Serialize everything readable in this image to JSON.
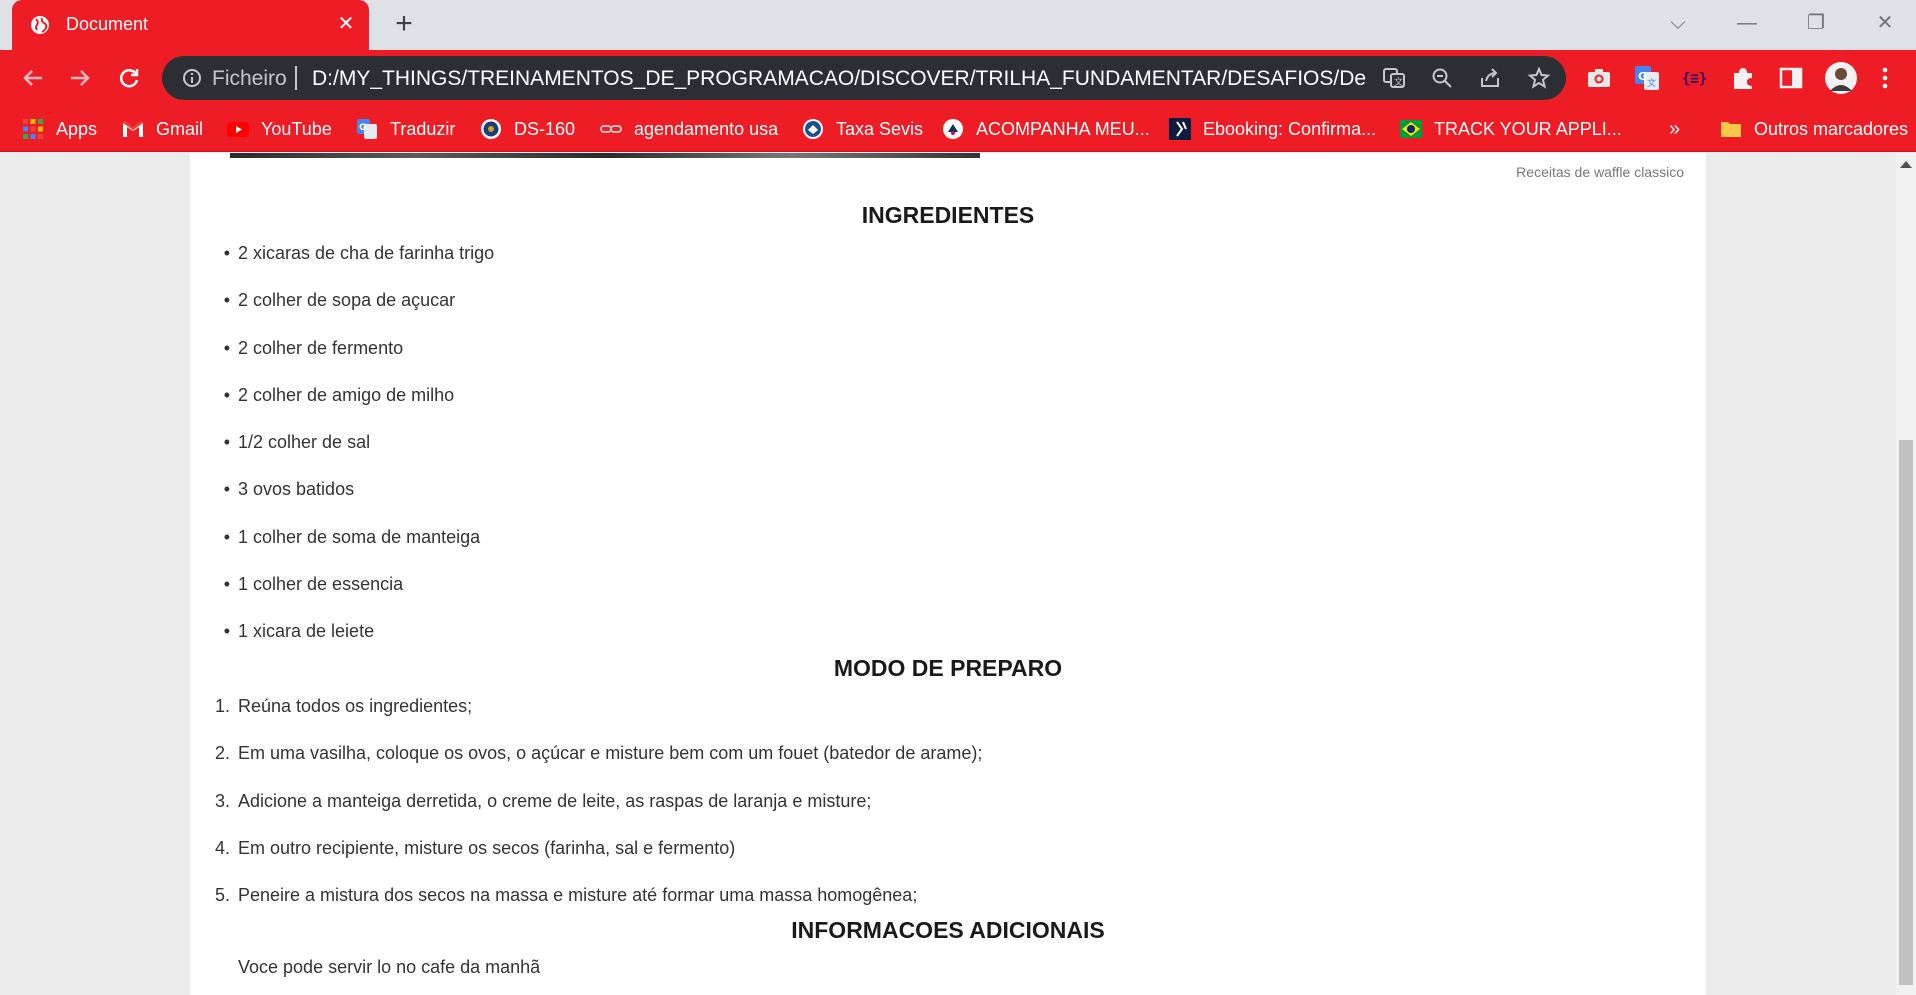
{
  "browser": {
    "tab_title": "Document",
    "tab_close": "✕",
    "new_tab": "+",
    "window_controls": {
      "dropdown": "⌵",
      "minimize": "—",
      "restore": "❐",
      "close": "✕"
    },
    "address": {
      "scheme_label": "Ficheiro",
      "url": "D:/MY_THINGS/TREINAMENTOS_DE_PROGRAMACAO/DISCOVER/TRILHA_FUNDAMENTAR/DESAFIOS/Desafio%..."
    },
    "bookmarks": [
      {
        "label": "Apps",
        "icon": "apps-grid-icon"
      },
      {
        "label": "Gmail",
        "icon": "gmail-icon"
      },
      {
        "label": "YouTube",
        "icon": "youtube-icon"
      },
      {
        "label": "Traduzir",
        "icon": "translate-icon"
      },
      {
        "label": "DS-160",
        "icon": "seal-icon"
      },
      {
        "label": "agendamento usa",
        "icon": "link-icon"
      },
      {
        "label": "Taxa Sevis",
        "icon": "dhs-seal-icon"
      },
      {
        "label": "ACOMPANHA MEU...",
        "icon": "uscis-icon"
      },
      {
        "label": "Ebooking: Confirma...",
        "icon": "ebooking-icon"
      },
      {
        "label": "TRACK YOUR APPLI...",
        "icon": "brazil-flag-icon"
      }
    ],
    "bookmarks_overflow": "»",
    "other_bookmarks": "Outros marcadores",
    "colors": {
      "chrome_red": "#ee1c25",
      "omnibox": "#2b2e33"
    }
  },
  "page": {
    "image_caption": "Receitas de waffle classico",
    "ingredients": {
      "title": "INGREDIENTES",
      "items": [
        "2 xicaras de cha de farinha trigo",
        "2 colher de sopa de açucar",
        "2 colher de fermento",
        "2 colher de amigo de milho",
        "1/2 colher de sal",
        "3 ovos batidos",
        "1 colher de soma de manteiga",
        "1 colher de essencia",
        "1 xicara de leiete"
      ]
    },
    "preparation": {
      "title": "MODO DE PREPARO",
      "steps": [
        "Reúna todos os ingredientes;",
        "Em uma vasilha, coloque os ovos, o açúcar e misture bem com um fouet (batedor de arame);",
        "Adicione a manteiga derretida, o creme de leite, as raspas de laranja e misture;",
        "Em outro recipiente, misture os secos (farinha, sal e fermento)",
        "Peneire a mistura dos secos na massa e misture até formar uma massa homogênea;"
      ],
      "markers": [
        "1.",
        "2.",
        "3.",
        "4.",
        "5."
      ],
      "bullet": "•"
    },
    "additional": {
      "title": "INFORMACOES ADICIONAIS",
      "text": "Voce pode servir lo no cafe da manhã"
    }
  }
}
